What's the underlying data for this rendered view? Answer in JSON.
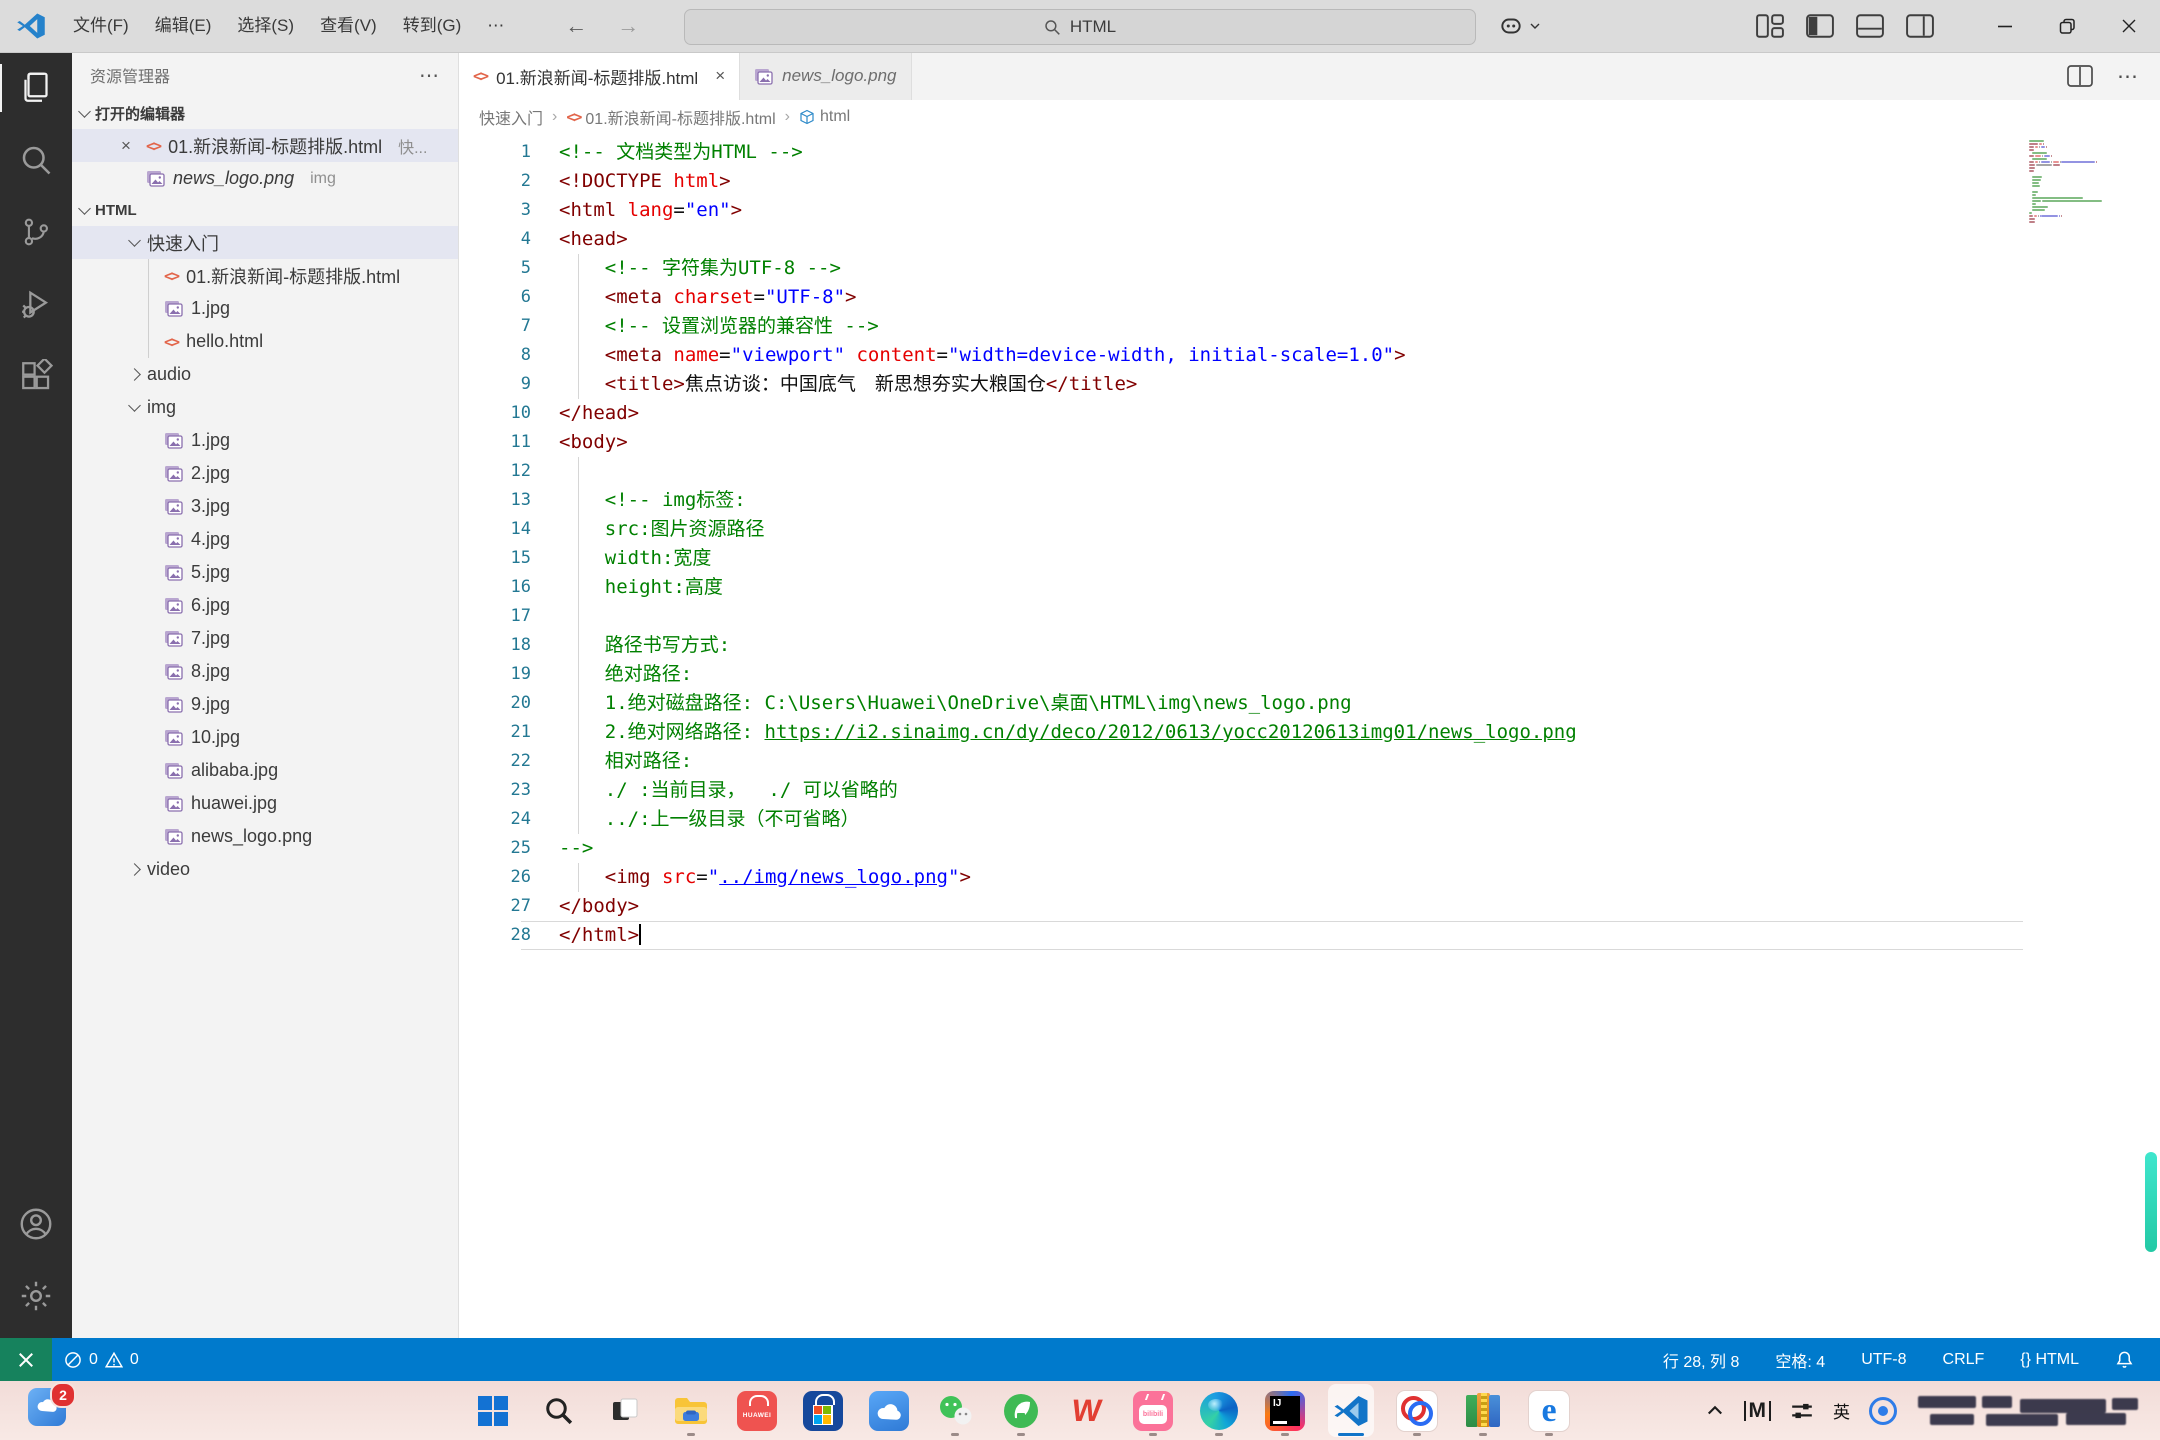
{
  "colors": {
    "statusbar_blue": "#007acc",
    "remote_green": "#16825d",
    "vscode_blue": "#1274c8",
    "comment_green": "#008000",
    "tag_maroon": "#800000",
    "attr_red": "#e50000",
    "value_blue": "#0000ff",
    "linenumber_teal": "#237893",
    "selection_row": "#e4e6f1",
    "taskbar_pink": "#f4dfdb"
  },
  "titlebar": {
    "menus": [
      {
        "id": "file",
        "label": "文件(F)"
      },
      {
        "id": "edit",
        "label": "编辑(E)"
      },
      {
        "id": "selection",
        "label": "选择(S)"
      },
      {
        "id": "view",
        "label": "查看(V)"
      },
      {
        "id": "goto",
        "label": "转到(G)"
      },
      {
        "id": "more",
        "label": "⋯"
      }
    ],
    "search_value": "HTML"
  },
  "activity_bar": {
    "items": [
      {
        "name": "explorer",
        "active": true
      },
      {
        "name": "search"
      },
      {
        "name": "source-control"
      },
      {
        "name": "run-debug"
      },
      {
        "name": "extensions"
      }
    ],
    "bottom": [
      {
        "name": "account"
      },
      {
        "name": "settings"
      }
    ]
  },
  "sidebar": {
    "title": "资源管理器",
    "more_label": "⋯",
    "open_editors_label": "打开的编辑器",
    "open_editors": [
      {
        "icon": "html",
        "label": "01.新浪新闻-标题排版.html",
        "desc": "快...",
        "selected": true,
        "close": "×"
      },
      {
        "icon": "image",
        "label": "news_logo.png",
        "desc": "img",
        "italic": true
      }
    ],
    "root_label": "HTML",
    "tree": [
      {
        "type": "folder",
        "label": "快速入门",
        "expanded": true,
        "selected": true,
        "indent": 1
      },
      {
        "type": "html",
        "label": "01.新浪新闻-标题排版.html",
        "indent": 2,
        "guide": true
      },
      {
        "type": "image",
        "label": "1.jpg",
        "indent": 2,
        "guide": true
      },
      {
        "type": "html",
        "label": "hello.html",
        "indent": 2,
        "guide": true
      },
      {
        "type": "folder",
        "label": "audio",
        "expanded": false,
        "indent": 1
      },
      {
        "type": "folder",
        "label": "img",
        "expanded": true,
        "indent": 1
      },
      {
        "type": "image",
        "label": "1.jpg",
        "indent": 2
      },
      {
        "type": "image",
        "label": "2.jpg",
        "indent": 2
      },
      {
        "type": "image",
        "label": "3.jpg",
        "indent": 2
      },
      {
        "type": "image",
        "label": "4.jpg",
        "indent": 2
      },
      {
        "type": "image",
        "label": "5.jpg",
        "indent": 2
      },
      {
        "type": "image",
        "label": "6.jpg",
        "indent": 2
      },
      {
        "type": "image",
        "label": "7.jpg",
        "indent": 2
      },
      {
        "type": "image",
        "label": "8.jpg",
        "indent": 2
      },
      {
        "type": "image",
        "label": "9.jpg",
        "indent": 2
      },
      {
        "type": "image",
        "label": "10.jpg",
        "indent": 2
      },
      {
        "type": "image",
        "label": "alibaba.jpg",
        "indent": 2
      },
      {
        "type": "image",
        "label": "huawei.jpg",
        "indent": 2
      },
      {
        "type": "image",
        "label": "news_logo.png",
        "indent": 2
      },
      {
        "type": "folder",
        "label": "video",
        "expanded": false,
        "indent": 1
      }
    ]
  },
  "editor": {
    "tabs": [
      {
        "icon": "html",
        "label": "01.新浪新闻-标题排版.html",
        "active": true,
        "close": "×"
      },
      {
        "icon": "image",
        "label": "news_logo.png",
        "italic": true
      }
    ],
    "breadcrumb": [
      {
        "label": "快速入门"
      },
      {
        "label": "01.新浪新闻-标题排版.html",
        "icon": "html"
      },
      {
        "label": "html",
        "icon": "symbol"
      }
    ],
    "current_line": 28,
    "lines": [
      {
        "n": 1,
        "tokens": [
          {
            "c": "cmt",
            "t": "<!-- 文档类型为HTML -->"
          }
        ]
      },
      {
        "n": 2,
        "tokens": [
          {
            "c": "tag",
            "t": "<!DOCTYPE "
          },
          {
            "c": "attr",
            "t": "html"
          },
          {
            "c": "tag",
            "t": ">"
          }
        ]
      },
      {
        "n": 3,
        "tokens": [
          {
            "c": "tag",
            "t": "<html "
          },
          {
            "c": "attr",
            "t": "lang"
          },
          {
            "c": "pln",
            "t": "="
          },
          {
            "c": "val",
            "t": "\"en\""
          },
          {
            "c": "tag",
            "t": ">"
          }
        ]
      },
      {
        "n": 4,
        "tokens": [
          {
            "c": "tag",
            "t": "<head>"
          }
        ]
      },
      {
        "n": 5,
        "guide": true,
        "tokens": [
          {
            "c": "cmt",
            "t": "    <!-- 字符集为UTF-8 -->"
          }
        ]
      },
      {
        "n": 6,
        "guide": true,
        "tokens": [
          {
            "c": "pln",
            "t": "    "
          },
          {
            "c": "tag",
            "t": "<meta "
          },
          {
            "c": "attr",
            "t": "charset"
          },
          {
            "c": "pln",
            "t": "="
          },
          {
            "c": "val",
            "t": "\"UTF-8\""
          },
          {
            "c": "tag",
            "t": ">"
          }
        ]
      },
      {
        "n": 7,
        "guide": true,
        "tokens": [
          {
            "c": "cmt",
            "t": "    <!-- 设置浏览器的兼容性 -->"
          }
        ]
      },
      {
        "n": 8,
        "guide": true,
        "tokens": [
          {
            "c": "pln",
            "t": "    "
          },
          {
            "c": "tag",
            "t": "<meta "
          },
          {
            "c": "attr",
            "t": "name"
          },
          {
            "c": "pln",
            "t": "="
          },
          {
            "c": "val",
            "t": "\"viewport\""
          },
          {
            "c": "pln",
            "t": " "
          },
          {
            "c": "attr",
            "t": "content"
          },
          {
            "c": "pln",
            "t": "="
          },
          {
            "c": "val",
            "t": "\"width=device-width, initial-scale=1.0\""
          },
          {
            "c": "tag",
            "t": ">"
          }
        ]
      },
      {
        "n": 9,
        "guide": true,
        "tokens": [
          {
            "c": "pln",
            "t": "    "
          },
          {
            "c": "tag",
            "t": "<title>"
          },
          {
            "c": "pln",
            "t": "焦点访谈：中国底气　新思想夯实大粮国仓"
          },
          {
            "c": "tag",
            "t": "</title>"
          }
        ]
      },
      {
        "n": 10,
        "tokens": [
          {
            "c": "tag",
            "t": "</head>"
          }
        ]
      },
      {
        "n": 11,
        "tokens": [
          {
            "c": "tag",
            "t": "<body>"
          }
        ]
      },
      {
        "n": 12,
        "guide": true,
        "tokens": []
      },
      {
        "n": 13,
        "guide": true,
        "tokens": [
          {
            "c": "cmt",
            "t": "    <!-- img标签:"
          }
        ]
      },
      {
        "n": 14,
        "guide": true,
        "tokens": [
          {
            "c": "cmt",
            "t": "    src:图片资源路径"
          }
        ]
      },
      {
        "n": 15,
        "guide": true,
        "tokens": [
          {
            "c": "cmt",
            "t": "    width:宽度"
          }
        ]
      },
      {
        "n": 16,
        "guide": true,
        "tokens": [
          {
            "c": "cmt",
            "t": "    height:高度"
          }
        ]
      },
      {
        "n": 17,
        "guide": true,
        "tokens": []
      },
      {
        "n": 18,
        "guide": true,
        "tokens": [
          {
            "c": "cmt",
            "t": "    路径书写方式:"
          }
        ]
      },
      {
        "n": 19,
        "guide": true,
        "tokens": [
          {
            "c": "cmt",
            "t": "    绝对路径:"
          }
        ]
      },
      {
        "n": 20,
        "guide": true,
        "tokens": [
          {
            "c": "cmt",
            "t": "    1.绝对磁盘路径: C:\\Users\\Huawei\\OneDrive\\桌面\\HTML\\img\\news_logo.png"
          }
        ]
      },
      {
        "n": 21,
        "guide": true,
        "tokens": [
          {
            "c": "cmt",
            "t": "    2.绝对网络路径: "
          },
          {
            "c": "lnkg",
            "t": "https://i2.sinaimg.cn/dy/deco/2012/0613/yocc20120613img01/news_logo.png"
          }
        ]
      },
      {
        "n": 22,
        "guide": true,
        "tokens": [
          {
            "c": "cmt",
            "t": "    相对路径:"
          }
        ]
      },
      {
        "n": 23,
        "guide": true,
        "tokens": [
          {
            "c": "cmt",
            "t": "    ./ :当前目录，  ./ 可以省略的"
          }
        ]
      },
      {
        "n": 24,
        "guide": true,
        "tokens": [
          {
            "c": "cmt",
            "t": "    ../:上一级目录（不可省略）"
          }
        ]
      },
      {
        "n": 25,
        "tokens": [
          {
            "c": "cmt",
            "t": "-->"
          }
        ]
      },
      {
        "n": 26,
        "guide": true,
        "tokens": [
          {
            "c": "pln",
            "t": "    "
          },
          {
            "c": "tag",
            "t": "<img "
          },
          {
            "c": "attr",
            "t": "src"
          },
          {
            "c": "pln",
            "t": "="
          },
          {
            "c": "val",
            "t": "\""
          },
          {
            "c": "lnkb",
            "t": "../img/news_logo.png"
          },
          {
            "c": "val",
            "t": "\""
          },
          {
            "c": "tag",
            "t": ">"
          }
        ]
      },
      {
        "n": 27,
        "tokens": [
          {
            "c": "tag",
            "t": "</body>"
          }
        ]
      },
      {
        "n": 28,
        "tokens": [
          {
            "c": "tag",
            "t": "</html>"
          }
        ]
      }
    ]
  },
  "status_bar": {
    "errors": "0",
    "warnings": "0",
    "line_col": "行 28, 列 8",
    "indent": "空格: 4",
    "encoding": "UTF-8",
    "eol": "CRLF",
    "lang_icon": "{}",
    "language": "HTML"
  },
  "taskbar": {
    "corner_badge": "2",
    "apps": [
      {
        "name": "start"
      },
      {
        "name": "search"
      },
      {
        "name": "task-view"
      },
      {
        "name": "file-explorer",
        "running": true
      },
      {
        "name": "huawei-store"
      },
      {
        "name": "microsoft-store"
      },
      {
        "name": "huawei-cloud"
      },
      {
        "name": "wechat",
        "running": true
      },
      {
        "name": "huawei-petal",
        "running": true
      },
      {
        "name": "wps-office"
      },
      {
        "name": "bilibili",
        "running": true
      },
      {
        "name": "edge",
        "running": true
      },
      {
        "name": "intellij-idea",
        "running": true
      },
      {
        "name": "vscode",
        "running": true,
        "active": true
      },
      {
        "name": "rings-app",
        "running": true
      },
      {
        "name": "winrar",
        "running": true
      },
      {
        "name": "e-browser",
        "running": true
      }
    ],
    "tray": {
      "ime": "英"
    },
    "store_label": "HUAWEI",
    "bilibili_label": "bilibili",
    "idea_label": "IJ",
    "wps_label": "W",
    "e_label": "e"
  }
}
